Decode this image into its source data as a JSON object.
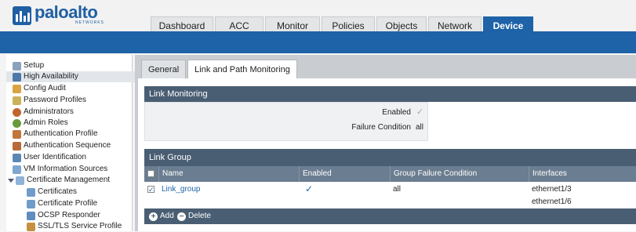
{
  "brand": {
    "name": "paloalto",
    "sub": "NETWORKS"
  },
  "tabs": [
    "Dashboard",
    "ACC",
    "Monitor",
    "Policies",
    "Objects",
    "Network",
    "Device"
  ],
  "active_tab": "Device",
  "sidebar": {
    "items": [
      {
        "label": "Setup",
        "icon": "setup-icon"
      },
      {
        "label": "High Availability",
        "icon": "high-availability-icon",
        "selected": true
      },
      {
        "label": "Config Audit",
        "icon": "config-audit-icon"
      },
      {
        "label": "Password Profiles",
        "icon": "password-profiles-icon"
      },
      {
        "label": "Administrators",
        "icon": "administrators-icon"
      },
      {
        "label": "Admin Roles",
        "icon": "admin-roles-icon"
      },
      {
        "label": "Authentication Profile",
        "icon": "authentication-profile-icon"
      },
      {
        "label": "Authentication Sequence",
        "icon": "authentication-sequence-icon"
      },
      {
        "label": "User Identification",
        "icon": "user-identification-icon"
      },
      {
        "label": "VM Information Sources",
        "icon": "vm-information-sources-icon"
      },
      {
        "label": "Certificate Management",
        "icon": "certificate-management-icon",
        "expanded": true
      },
      {
        "label": "Certificates",
        "icon": "certificates-icon",
        "child": true
      },
      {
        "label": "Certificate Profile",
        "icon": "certificate-profile-icon",
        "child": true
      },
      {
        "label": "OCSP Responder",
        "icon": "ocsp-responder-icon",
        "child": true
      },
      {
        "label": "SSL/TLS Service Profile",
        "icon": "ssl-tls-service-profile-icon",
        "child": true
      }
    ]
  },
  "subtabs": [
    "General",
    "Link and Path Monitoring"
  ],
  "active_subtab": "Link and Path Monitoring",
  "link_monitoring": {
    "title": "Link Monitoring",
    "enabled_label": "Enabled",
    "enabled": true,
    "failure_label": "Failure Condition",
    "failure_value": "all"
  },
  "link_group": {
    "title": "Link Group",
    "columns": [
      "Name",
      "Enabled",
      "Group Failure Condition",
      "Interfaces"
    ],
    "rows": [
      {
        "name": "Link_group",
        "enabled": true,
        "failure": "all",
        "interfaces": [
          "ethernet1/3",
          "ethernet1/6"
        ]
      }
    ],
    "add_label": "Add",
    "delete_label": "Delete"
  },
  "colors": {
    "accent": "#1e62a8",
    "section_header": "#4a5e73"
  }
}
